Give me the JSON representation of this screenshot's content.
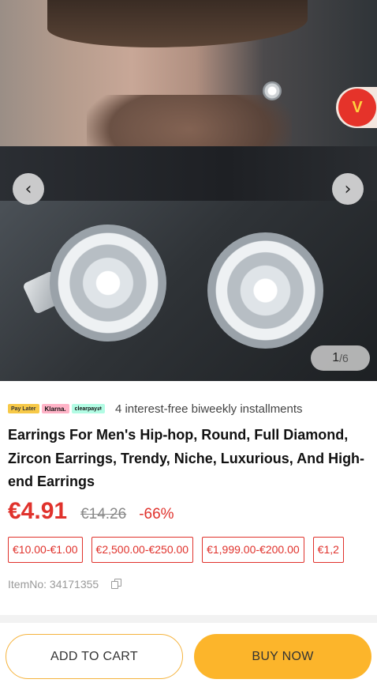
{
  "gallery": {
    "current": "1",
    "total": "/6",
    "prev_icon": "chevron-left-icon",
    "next_icon": "chevron-right-icon",
    "prev_glyph": "‹",
    "next_glyph": "›",
    "store_badge_icon": "store-logo-icon"
  },
  "payment": {
    "logos": [
      "Pay Later",
      "Klarna.",
      "clearpay⇄"
    ],
    "text": "4 interest-free biweekly installments"
  },
  "product": {
    "title": "Earrings For Men's Hip-hop, Round, Full Diamond, Zircon Earrings, Trendy, Niche, Luxurious, And High-end Earrings",
    "price": "€4.91",
    "original_price": "€14.26",
    "discount": "-66%",
    "coupons": [
      "€10.00-€1.00",
      "€2,500.00-€250.00",
      "€1,999.00-€200.00",
      "€1,2"
    ],
    "item_no": "ItemNo: 34171355",
    "copy_icon": "copy-icon"
  },
  "actions": {
    "add_to_cart": "ADD TO CART",
    "buy_now": "BUY NOW"
  },
  "colors": {
    "accent_red": "#e0322c",
    "button_yellow": "#fcb52b"
  }
}
